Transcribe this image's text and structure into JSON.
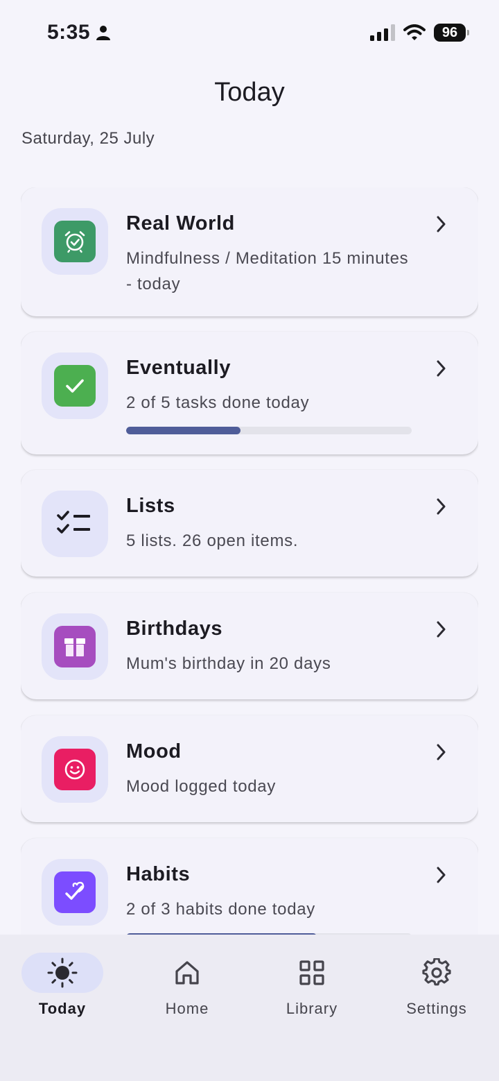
{
  "status_bar": {
    "time": "5:35",
    "battery": "96"
  },
  "page_title": "Today",
  "date": "Saturday, 25 July",
  "cards": [
    {
      "title": "Real World",
      "subtitle": "Mindfulness / Meditation 15 minutes - today",
      "icon": "alarm-clock-check-icon",
      "color": "#3d9a67"
    },
    {
      "title": "Eventually",
      "subtitle": "2 of 5 tasks done today",
      "icon": "checkmark-icon",
      "color": "#4caf50",
      "progress": 0.4
    },
    {
      "title": "Lists",
      "subtitle": "5 lists. 26 open items.",
      "icon": "checklist-icon",
      "color": "#1c1b22"
    },
    {
      "title": "Birthdays",
      "subtitle": "Mum's birthday in 20 days",
      "icon": "gift-icon",
      "color": "#a64dbf"
    },
    {
      "title": "Mood",
      "subtitle": "Mood logged today",
      "icon": "smiley-icon",
      "color": "#e91e63"
    },
    {
      "title": "Habits",
      "subtitle": "2 of 3 habits done today",
      "icon": "heart-check-icon",
      "color": "#7c4dff",
      "progress": 0.667
    }
  ],
  "nav": [
    {
      "label": "Today",
      "icon": "sun-icon",
      "active": true
    },
    {
      "label": "Home",
      "icon": "home-icon",
      "active": false
    },
    {
      "label": "Library",
      "icon": "grid-icon",
      "active": false
    },
    {
      "label": "Settings",
      "icon": "gear-icon",
      "active": false
    }
  ]
}
